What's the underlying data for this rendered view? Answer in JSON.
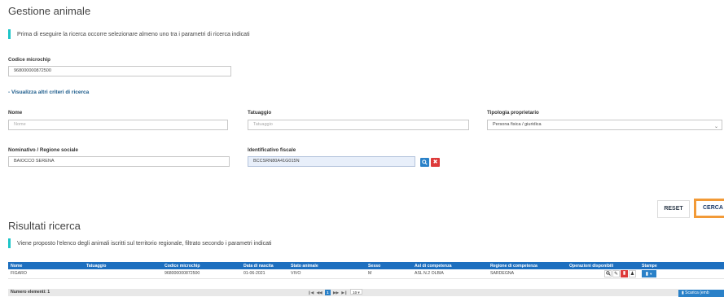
{
  "page": {
    "title": "Gestione animale"
  },
  "info": {
    "text": "Prima di eseguire la ricerca occorre selezionare almeno uno tra i parametri di ricerca indicati"
  },
  "microchip": {
    "label": "Codice microchip",
    "value": "968000000872500"
  },
  "more_criteria": {
    "label": "- Visualizza altri criteri di ricerca"
  },
  "fields": {
    "nome": {
      "label": "Nome",
      "placeholder": "Nome"
    },
    "tatuaggio": {
      "label": "Tatuaggio",
      "placeholder": "Tatuaggio"
    },
    "tipologia": {
      "label": "Tipologia proprietario",
      "value": "Persona fisica / giuridica"
    },
    "nominativo": {
      "label": "Nominativo / Regione sociale",
      "value": "BAIOCCO SERENA"
    },
    "identificativo": {
      "label": "Identificativo fiscale",
      "value": "BCCSRN80A41G015N"
    }
  },
  "icons": {
    "search": "search-icon",
    "clear": "close-icon"
  },
  "buttons": {
    "reset": "RESET",
    "cerca": "CERCA"
  },
  "results": {
    "title": "Risultati ricerca",
    "info": "Viene proposto l'elenco degli animali iscritti sul territorio regionale, filtrato secondo i parametri indicati",
    "columns": [
      "Nome",
      "Tatuaggio",
      "Codice microchip",
      "Data di nascita",
      "Stato animale",
      "Sesso",
      "Asl di competenza",
      "Regione di competenza",
      "Operazioni disponibili",
      "Stampe"
    ],
    "rows": [
      {
        "nome": "FIGARO",
        "tatuaggio": "",
        "microchip": "968000000872500",
        "nascita": "01-06-2021",
        "stato": "VIVO",
        "sesso": "M",
        "asl": "ASL N.2 OLBIA",
        "regione": "SARDEGNA"
      }
    ],
    "count_label": "Numero elementi: 1",
    "pager": {
      "current": "1",
      "page_size": "10"
    },
    "download_label": "Scarica (emb"
  },
  "colors": {
    "header": "#1d6fbf",
    "accent": "#1ec5c8",
    "cerca_border": "#f29a37",
    "danger": "#dd3a3a"
  }
}
